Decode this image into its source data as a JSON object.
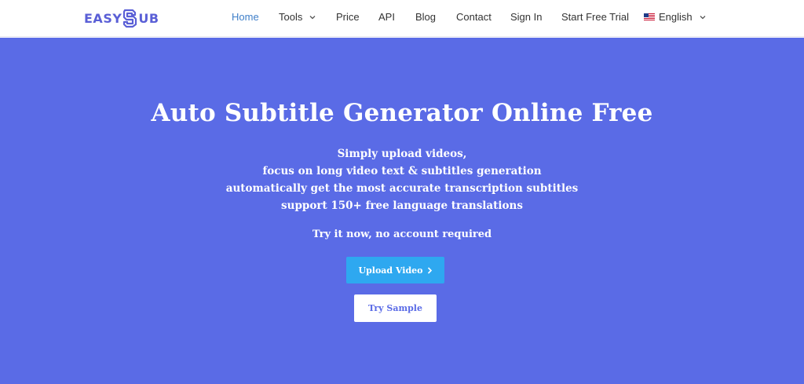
{
  "brand": {
    "logo_left": "EASY",
    "logo_right": "UB",
    "color": "#5a5fd6"
  },
  "nav": {
    "items": [
      {
        "label": "Home",
        "active": true
      },
      {
        "label": "Tools",
        "has_dropdown": true
      },
      {
        "label": "Price"
      },
      {
        "label": "API"
      },
      {
        "label": "Blog"
      },
      {
        "label": "Contact"
      },
      {
        "label": "Sign In"
      },
      {
        "label": "Start Free Trial"
      },
      {
        "label": "English",
        "has_dropdown": true,
        "icon": "us-flag-icon"
      }
    ],
    "active_color": "#3f7fc9"
  },
  "hero": {
    "background": "#5a6be6",
    "title": "Auto Subtitle Generator Online Free",
    "lines": [
      "Simply upload videos,",
      "focus on long video text & subtitles generation",
      "automatically get the most accurate transcription subtitles",
      "support 150+ free language translations"
    ],
    "note": "Try it now, no account required",
    "upload_button": "Upload Video",
    "upload_button_color": "#2ea8f0",
    "sample_button": "Try Sample"
  }
}
